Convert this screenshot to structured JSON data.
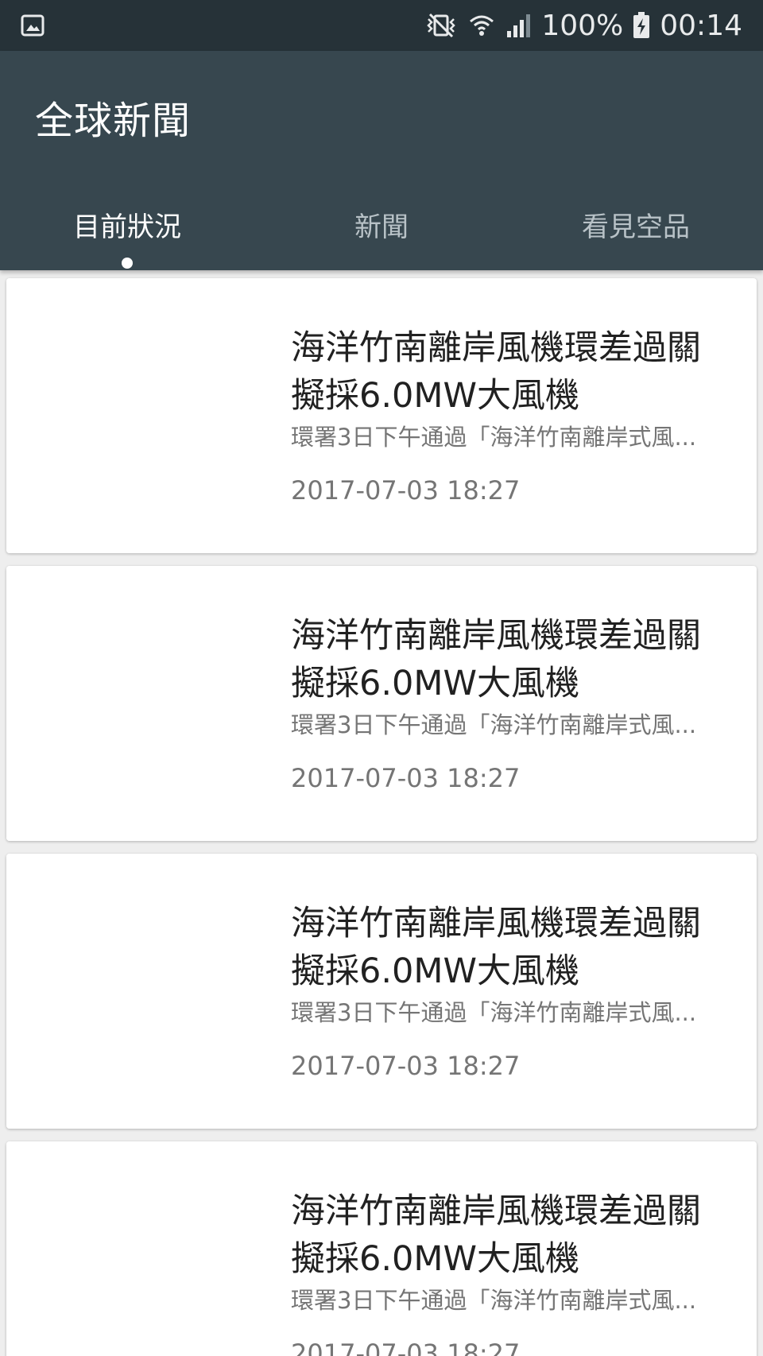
{
  "status_bar": {
    "left_icon": "image-icon",
    "battery": "100%",
    "time": "00:14",
    "icons": [
      "vibrate-mute-icon",
      "wifi-icon",
      "signal-icon",
      "battery-charging-icon"
    ]
  },
  "app_bar": {
    "title": "全球新聞",
    "background": "#37474f"
  },
  "tabs": [
    {
      "label": "目前狀況",
      "active": true
    },
    {
      "label": "新聞",
      "active": false
    },
    {
      "label": "看見空品",
      "active": false
    }
  ],
  "news": [
    {
      "title": "海洋竹南離岸風機環差過關 擬採6.0MW大風機",
      "summary": "環署3日下午通過「海洋竹南離岸式風...",
      "date": "2017-07-03 18:27"
    },
    {
      "title": "海洋竹南離岸風機環差過關 擬採6.0MW大風機",
      "summary": "環署3日下午通過「海洋竹南離岸式風...",
      "date": "2017-07-03 18:27"
    },
    {
      "title": "海洋竹南離岸風機環差過關 擬採6.0MW大風機",
      "summary": "環署3日下午通過「海洋竹南離岸式風...",
      "date": "2017-07-03 18:27"
    },
    {
      "title": "海洋竹南離岸風機環差過關 擬採6.0MW大風機",
      "summary": "環署3日下午通過「海洋竹南離岸式風...",
      "date": "2017-07-03 18:27"
    }
  ]
}
